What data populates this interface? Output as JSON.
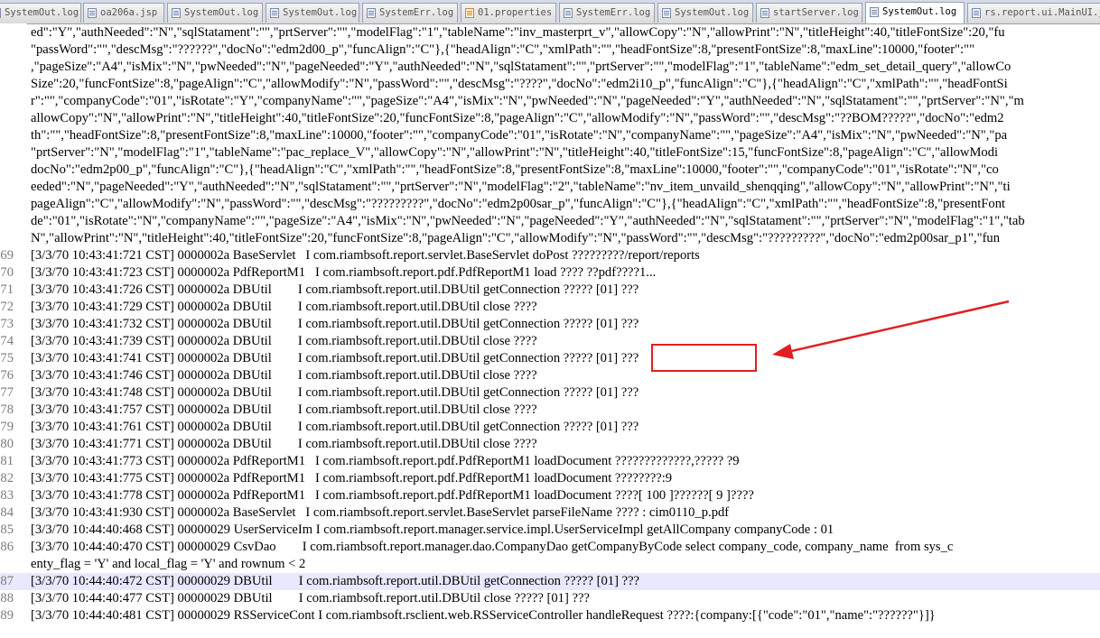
{
  "tabs": [
    {
      "label": "SystemOut.log",
      "active": false,
      "icon": "file-icon"
    },
    {
      "label": "oa206a.jsp",
      "active": false,
      "icon": "file-icon"
    },
    {
      "label": "SystemOut.log",
      "active": false,
      "icon": "file-icon"
    },
    {
      "label": "SystemOut.log",
      "active": false,
      "icon": "file-icon"
    },
    {
      "label": "SystemErr.log",
      "active": false,
      "icon": "file-icon"
    },
    {
      "label": "01.properties",
      "active": false,
      "icon": "file-icon"
    },
    {
      "label": "SystemErr.log",
      "active": false,
      "icon": "file-icon"
    },
    {
      "label": "SystemOut.log",
      "active": false,
      "icon": "file-icon"
    },
    {
      "label": "startServer.log",
      "active": false,
      "icon": "file-icon"
    },
    {
      "label": "SystemOut.log",
      "active": true,
      "icon": "file-icon"
    },
    {
      "label": "rs.report.ui.MainUI.j",
      "active": false,
      "icon": "file-icon"
    }
  ],
  "editor": {
    "highlight_color": "#e8e8ff",
    "lines": [
      {
        "num": "",
        "text": "ed\":\"Y\",\"authNeeded\":\"N\",\"sqlStatament\":\"\",\"prtServer\":\"\",\"modelFlag\":\"1\",\"tableName\":\"inv_masterprt_v\",\"allowCopy\":\"N\",\"allowPrint\":\"N\",\"titleHeight\":40,\"titleFontSize\":20,\"fu"
      },
      {
        "num": "",
        "text": "\"passWord\":\"\",\"descMsg\":\"??????\",\"docNo\":\"edm2d00_p\",\"funcAlign\":\"C\"},{\"headAlign\":\"C\",\"xmlPath\":\"\",\"headFontSize\":8,\"presentFontSize\":8,\"maxLine\":10000,\"footer\":\"\""
      },
      {
        "num": "",
        "text": ",\"pageSize\":\"A4\",\"isMix\":\"N\",\"pwNeeded\":\"N\",\"pageNeeded\":\"Y\",\"authNeeded\":\"N\",\"sqlStatament\":\"\",\"prtServer\":\"\",\"modelFlag\":\"1\",\"tableName\":\"edm_set_detail_query\",\"allowCo"
      },
      {
        "num": "",
        "text": "Size\":20,\"funcFontSize\":8,\"pageAlign\":\"C\",\"allowModify\":\"N\",\"passWord\":\"\",\"descMsg\":\"????\",\"docNo\":\"edm2i10_p\",\"funcAlign\":\"C\"},{\"headAlign\":\"C\",\"xmlPath\":\"\",\"headFontSi"
      },
      {
        "num": "",
        "text": "r\":\"\",\"companyCode\":\"01\",\"isRotate\":\"Y\",\"companyName\":\"\",\"pageSize\":\"A4\",\"isMix\":\"N\",\"pwNeeded\":\"N\",\"pageNeeded\":\"Y\",\"authNeeded\":\"N\",\"sqlStatament\":\"\",\"prtServer\":\"N\",\"m"
      },
      {
        "num": "",
        "text": "allowCopy\":\"N\",\"allowPrint\":\"N\",\"titleHeight\":40,\"titleFontSize\":20,\"funcFontSize\":8,\"pageAlign\":\"C\",\"allowModify\":\"N\",\"passWord\":\"\",\"descMsg\":\"??BOM?????\",\"docNo\":\"edm2"
      },
      {
        "num": "",
        "text": "th\":\"\",\"headFontSize\":8,\"presentFontSize\":8,\"maxLine\":10000,\"footer\":\"\",\"companyCode\":\"01\",\"isRotate\":\"N\",\"companyName\":\"\",\"pageSize\":\"A4\",\"isMix\":\"N\",\"pwNeeded\":\"N\",\"pa"
      },
      {
        "num": "",
        "text": "\"prtServer\":\"N\",\"modelFlag\":\"1\",\"tableName\":\"pac_replace_V\",\"allowCopy\":\"N\",\"allowPrint\":\"N\",\"titleHeight\":40,\"titleFontSize\":15,\"funcFontSize\":8,\"pageAlign\":\"C\",\"allowModi"
      },
      {
        "num": "",
        "text": "docNo\":\"edm2p00_p\",\"funcAlign\":\"C\"},{\"headAlign\":\"C\",\"xmlPath\":\"\",\"headFontSize\":8,\"presentFontSize\":8,\"maxLine\":10000,\"footer\":\"\",\"companyCode\":\"01\",\"isRotate\":\"N\",\"co"
      },
      {
        "num": "",
        "text": "eeded\":\"N\",\"pageNeeded\":\"Y\",\"authNeeded\":\"N\",\"sqlStatament\":\"\",\"prtServer\":\"N\",\"modelFlag\":\"2\",\"tableName\":\"nv_item_unvaild_shenqqing\",\"allowCopy\":\"N\",\"allowPrint\":\"N\",\"ti"
      },
      {
        "num": "",
        "text": "pageAlign\":\"C\",\"allowModify\":\"N\",\"passWord\":\"\",\"descMsg\":\"?????????\",\"docNo\":\"edm2p00sar_p\",\"funcAlign\":\"C\"},{\"headAlign\":\"C\",\"xmlPath\":\"\",\"headFontSize\":8,\"presentFont"
      },
      {
        "num": "",
        "text": "de\":\"01\",\"isRotate\":\"N\",\"companyName\":\"\",\"pageSize\":\"A4\",\"isMix\":\"N\",\"pwNeeded\":\"N\",\"pageNeeded\":\"Y\",\"authNeeded\":\"N\",\"sqlStatament\":\"\",\"prtServer\":\"N\",\"modelFlag\":\"1\",\"tab"
      },
      {
        "num": "",
        "text": "N\",\"allowPrint\":\"N\",\"titleHeight\":40,\"titleFontSize\":20,\"funcFontSize\":8,\"pageAlign\":\"C\",\"allowModify\":\"N\",\"passWord\":\"\",\"descMsg\":\"?????????\",\"docNo\":\"edm2p00sar_p1\",\"fun"
      },
      {
        "num": "69",
        "text": "[3/3/70 10:43:41:721 CST] 0000002a BaseServlet   I com.riambsoft.report.servlet.BaseServlet doPost ?????????/report/reports"
      },
      {
        "num": "70",
        "text": "[3/3/70 10:43:41:723 CST] 0000002a PdfReportM1   I com.riambsoft.report.pdf.PdfReportM1 load ???? ??pdf????1..."
      },
      {
        "num": "71",
        "text": "[3/3/70 10:43:41:726 CST] 0000002a DBUtil        I com.riambsoft.report.util.DBUtil getConnection ????? [01] ???"
      },
      {
        "num": "72",
        "text": "[3/3/70 10:43:41:729 CST] 0000002a DBUtil        I com.riambsoft.report.util.DBUtil close ????"
      },
      {
        "num": "73",
        "text": "[3/3/70 10:43:41:732 CST] 0000002a DBUtil        I com.riambsoft.report.util.DBUtil getConnection ????? [01] ???"
      },
      {
        "num": "74",
        "text": "[3/3/70 10:43:41:739 CST] 0000002a DBUtil        I com.riambsoft.report.util.DBUtil close ????"
      },
      {
        "num": "75",
        "text": "[3/3/70 10:43:41:741 CST] 0000002a DBUtil        I com.riambsoft.report.util.DBUtil getConnection ????? [01] ???"
      },
      {
        "num": "76",
        "text": "[3/3/70 10:43:41:746 CST] 0000002a DBUtil        I com.riambsoft.report.util.DBUtil close ????"
      },
      {
        "num": "77",
        "text": "[3/3/70 10:43:41:748 CST] 0000002a DBUtil        I com.riambsoft.report.util.DBUtil getConnection ????? [01] ???"
      },
      {
        "num": "78",
        "text": "[3/3/70 10:43:41:757 CST] 0000002a DBUtil        I com.riambsoft.report.util.DBUtil close ????"
      },
      {
        "num": "79",
        "text": "[3/3/70 10:43:41:761 CST] 0000002a DBUtil        I com.riambsoft.report.util.DBUtil getConnection ????? [01] ???"
      },
      {
        "num": "80",
        "text": "[3/3/70 10:43:41:771 CST] 0000002a DBUtil        I com.riambsoft.report.util.DBUtil close ????"
      },
      {
        "num": "81",
        "text": "[3/3/70 10:43:41:773 CST] 0000002a PdfReportM1   I com.riambsoft.report.pdf.PdfReportM1 loadDocument ?????????????,????? ?9"
      },
      {
        "num": "82",
        "text": "[3/3/70 10:43:41:775 CST] 0000002a PdfReportM1   I com.riambsoft.report.pdf.PdfReportM1 loadDocument ????????:9"
      },
      {
        "num": "83",
        "text": "[3/3/70 10:43:41:778 CST] 0000002a PdfReportM1   I com.riambsoft.report.pdf.PdfReportM1 loadDocument ????[ 100 ]??????[ 9 ]????"
      },
      {
        "num": "84",
        "text": "[3/3/70 10:43:41:930 CST] 0000002a BaseServlet   I com.riambsoft.report.servlet.BaseServlet parseFileName ???? : cim0110_p.pdf"
      },
      {
        "num": "85",
        "text": "[3/3/70 10:44:40:468 CST] 00000029 UserServiceIm I com.riambsoft.report.manager.service.impl.UserServiceImpl getAllCompany companyCode : 01"
      },
      {
        "num": "86",
        "text": "[3/3/70 10:44:40:470 CST] 00000029 CsvDao        I com.riambsoft.report.manager.dao.CompanyDao getCompanyByCode select company_code, company_name  from sys_c"
      },
      {
        "num": "",
        "text": "enty_flag = 'Y' and local_flag = 'Y' and rownum < 2"
      },
      {
        "num": "87",
        "text": "[3/3/70 10:44:40:472 CST] 00000029 DBUtil        I com.riambsoft.report.util.DBUtil getConnection ????? [01] ???"
      },
      {
        "num": "88",
        "text": "[3/3/70 10:44:40:477 CST] 00000029 DBUtil        I com.riambsoft.report.util.DBUtil close ????? [01] ???"
      },
      {
        "num": "89",
        "text": "[3/3/70 10:44:40:481 CST] 00000029 RSServiceCont I com.riambsoft.rsclient.web.RSServiceController handleRequest ????:{company:[{\"code\":\"01\",\"name\":\"??????\"}]}"
      }
    ]
  },
  "annotation": {
    "color": "#e02020"
  }
}
